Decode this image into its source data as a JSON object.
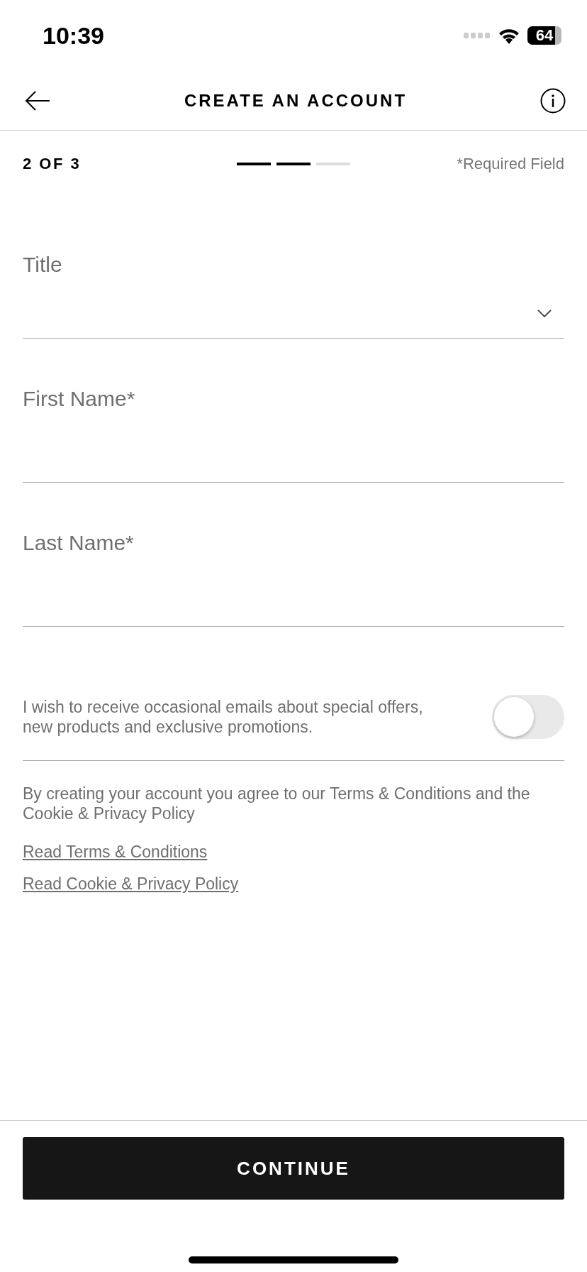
{
  "status_bar": {
    "time": "10:39",
    "battery": "64"
  },
  "header": {
    "title": "CREATE AN ACCOUNT"
  },
  "progress": {
    "step_text": "2 OF 3",
    "steps": [
      {
        "done": true
      },
      {
        "done": true
      },
      {
        "done": false
      }
    ],
    "note": "*Required Field"
  },
  "fields": [
    {
      "kind": "dropdown",
      "placeholder": "Title"
    },
    {
      "kind": "text",
      "placeholder": "First Name*"
    },
    {
      "kind": "text",
      "placeholder": "Last Name*"
    }
  ],
  "newsletter": {
    "text": "I wish to receive occasional emails about special offers, new products and exclusive promotions.",
    "on": false
  },
  "consent": "By creating your account you agree to our Terms & Conditions and the Cookie & Privacy Policy",
  "links": [
    "Read Terms & Conditions",
    "Read Cookie & Privacy Policy"
  ],
  "button": "CONTINUE"
}
